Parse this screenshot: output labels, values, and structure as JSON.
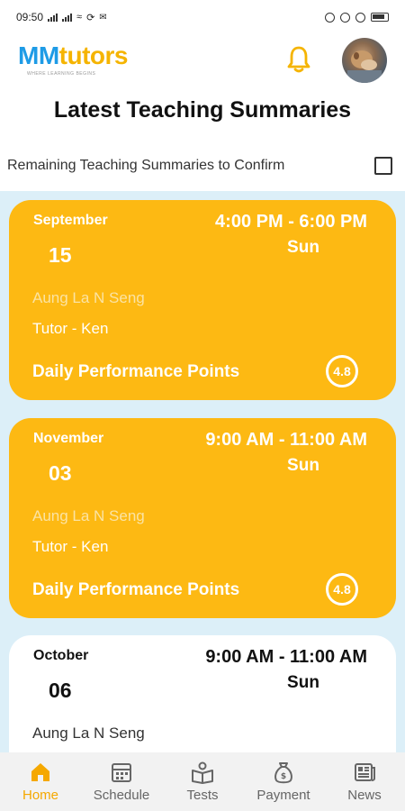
{
  "status_bar": {
    "time": "09:50",
    "network_speed": "",
    "battery_icon": "battery-icon"
  },
  "header": {
    "logo_main": "MM",
    "logo_accent": "tutors",
    "logo_tagline": "WHERE LEARNING BEGINS",
    "bell_icon": "bell-icon",
    "avatar_icon": "profile-avatar"
  },
  "page": {
    "title": "Latest Teaching Summaries",
    "confirm_label": "Remaining Teaching Summaries to Confirm",
    "confirm_checked": false
  },
  "summaries": [
    {
      "month": "September",
      "day": "15",
      "time": "4:00 PM - 6:00 PM",
      "weekday": "Sun",
      "student": "Aung La N Seng",
      "tutor": "Tutor - Ken",
      "performance_label": "Daily Performance Points",
      "score": "4.8",
      "style": "yellow"
    },
    {
      "month": "November",
      "day": "03",
      "time": "9:00 AM - 11:00 AM",
      "weekday": "Sun",
      "student": "Aung La N Seng",
      "tutor": "Tutor - Ken",
      "performance_label": "Daily Performance Points",
      "score": "4.8",
      "style": "yellow"
    },
    {
      "month": "October",
      "day": "06",
      "time": "9:00 AM - 11:00 AM",
      "weekday": "Sun",
      "student": "Aung La N Seng",
      "style": "white"
    }
  ],
  "nav": [
    {
      "label": "Home",
      "icon": "home-icon",
      "active": true
    },
    {
      "label": "Schedule",
      "icon": "calendar-icon",
      "active": false
    },
    {
      "label": "Tests",
      "icon": "book-icon",
      "active": false
    },
    {
      "label": "Payment",
      "icon": "money-bag-icon",
      "active": false
    },
    {
      "label": "News",
      "icon": "newspaper-icon",
      "active": false
    }
  ],
  "colors": {
    "accent_yellow": "#fdb913",
    "logo_blue": "#1e9be6",
    "list_background": "#dceff8",
    "nav_active": "#f5a800"
  }
}
